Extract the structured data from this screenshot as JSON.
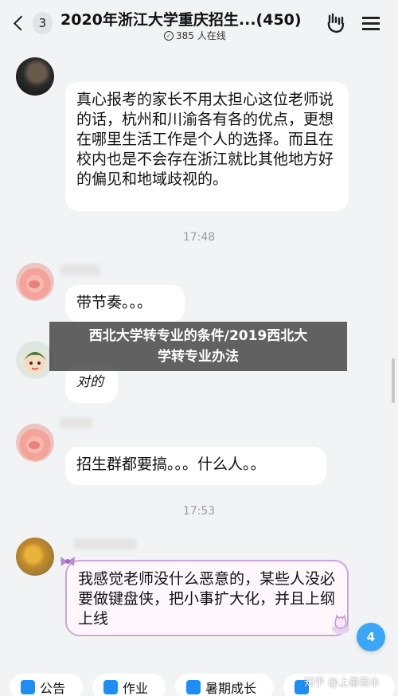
{
  "header": {
    "unread_count": "3",
    "title": "2020年浙江大学重庆招生...(450)",
    "online_text": "385 人在线"
  },
  "messages": [
    {
      "text": "真心报考的家长不用太担心这位老师说的话，杭州和川渝各有各的优点，更想在哪里生活工作是个人的选择。而且在校内也是不会存在浙江就比其他地方好的偏见和地域歧视的。"
    },
    {
      "text": "带节奏。。。"
    },
    {
      "text": "对的"
    },
    {
      "text": "招生群都要搞。。。什么人。。"
    },
    {
      "text": "我感觉老师没什么恶意的，某些人没必要做键盘侠，把小事扩大化，并且上纲上线"
    }
  ],
  "timestamps": [
    "17:48",
    "17:53"
  ],
  "banner": {
    "line1": "西北大学转专业的条件/2019西北大",
    "line2": "学转专业办法"
  },
  "new_messages_count": "4",
  "bottom_tabs": [
    {
      "label": "公告",
      "icon": "announcement-icon"
    },
    {
      "label": "作业",
      "icon": "homework-icon"
    },
    {
      "label": "暑期成长",
      "icon": "summer-growth-icon"
    },
    {
      "label": "",
      "icon": "group-icon"
    }
  ],
  "watermark": "知乎 @上善若水",
  "colors": {
    "background": "#f2f3f5",
    "bubble": "#ffffff",
    "accent": "#3aa6f4"
  }
}
